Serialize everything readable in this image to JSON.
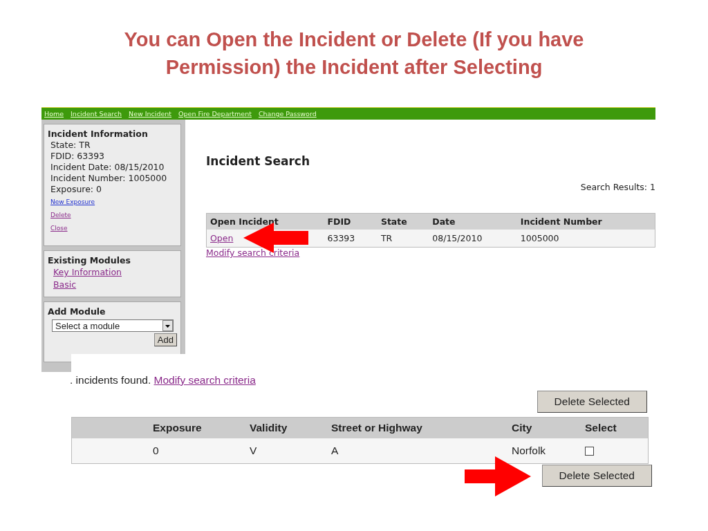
{
  "slide_title": "You can Open the Incident or Delete (If you have Permission) the Incident after Selecting",
  "nav": [
    "Home",
    "Incident Search",
    "New Incident",
    "Open Fire Department",
    "Change Password"
  ],
  "incident_info": {
    "heading": "Incident Information",
    "fields": [
      "State: TR",
      "FDID: 63393",
      "Incident Date: 08/15/2010",
      "Incident Number: 1005000",
      "Exposure: 0"
    ],
    "links": [
      "New Exposure",
      "Delete",
      "Close"
    ]
  },
  "existing_modules": {
    "heading": "Existing Modules",
    "links": [
      "Key Information",
      "Basic"
    ]
  },
  "add_module": {
    "heading": "Add Module",
    "select": "Select a module",
    "button": "Add"
  },
  "search": {
    "title": "Incident Search",
    "results": "Search Results: 1",
    "columns": [
      "Open Incident",
      "FDID",
      "State",
      "Date",
      "Incident Number"
    ],
    "rows": [
      [
        "Open",
        "63393",
        "TR",
        "08/15/2010",
        "1005000"
      ]
    ],
    "modify": "Modify search criteria"
  },
  "results": {
    "found": ". incidents found.",
    "modify": "Modify search criteria",
    "button_top": "Delete Selected",
    "columns": [
      "Exposure",
      "Validity",
      "Street or Highway",
      "City",
      "Select"
    ],
    "rows": [
      {
        "cells": [
          "0",
          "V",
          "A",
          "Norfolk"
        ],
        "checked": false
      }
    ],
    "button_bottom": "Delete Selected"
  }
}
